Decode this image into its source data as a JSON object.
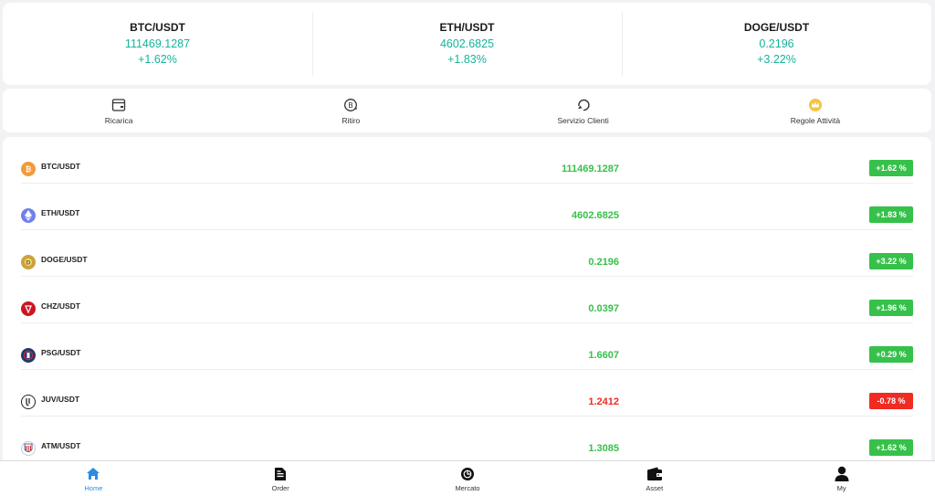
{
  "tickers": [
    {
      "pair": "BTC/USDT",
      "price": "111469.1287",
      "change": "+1.62%"
    },
    {
      "pair": "ETH/USDT",
      "price": "4602.6825",
      "change": "+1.83%"
    },
    {
      "pair": "DOGE/USDT",
      "price": "0.2196",
      "change": "+3.22%"
    }
  ],
  "actions": [
    {
      "label": "Ricarica",
      "icon": "wallet-card-icon"
    },
    {
      "label": "Ritiro",
      "icon": "withdraw-icon"
    },
    {
      "label": "Servizio Clienti",
      "icon": "customer-service-icon"
    },
    {
      "label": "Regole Attività",
      "icon": "activity-rules-crown-icon"
    }
  ],
  "market": {
    "colors": {
      "up": "#36c14a",
      "down": "#ef2b22"
    },
    "rows": [
      {
        "symbol": "BTC/USDT",
        "price": "111469.1287",
        "change": "+1.62 %",
        "trend": "up",
        "coin_icon": "bitcoin-icon",
        "coin_color": "#f39a3c"
      },
      {
        "symbol": "ETH/USDT",
        "price": "4602.6825",
        "change": "+1.83 %",
        "trend": "up",
        "coin_icon": "ethereum-icon",
        "coin_color": "#6f7ef0"
      },
      {
        "symbol": "DOGE/USDT",
        "price": "0.2196",
        "change": "+3.22 %",
        "trend": "up",
        "coin_icon": "dogecoin-icon",
        "coin_color": "#c9a43a"
      },
      {
        "symbol": "CHZ/USDT",
        "price": "0.0397",
        "change": "+1.96 %",
        "trend": "up",
        "coin_icon": "chiliz-icon",
        "coin_color": "#cd1422"
      },
      {
        "symbol": "PSG/USDT",
        "price": "1.6607",
        "change": "+0.29 %",
        "trend": "up",
        "coin_icon": "psg-icon",
        "coin_color": "#1e3a6e"
      },
      {
        "symbol": "JUV/USDT",
        "price": "1.2412",
        "change": "-0.78 %",
        "trend": "down",
        "coin_icon": "juventus-icon",
        "coin_color": "#ffffff"
      },
      {
        "symbol": "ATM/USDT",
        "price": "1.3085",
        "change": "+1.62 %",
        "trend": "up",
        "coin_icon": "atletico-icon",
        "coin_color": "#ffffff"
      }
    ]
  },
  "tabs": [
    {
      "label": "Home",
      "icon": "home-icon",
      "active": true
    },
    {
      "label": "Order",
      "icon": "order-document-icon",
      "active": false
    },
    {
      "label": "Mercato",
      "icon": "market-icon",
      "active": false
    },
    {
      "label": "Asset",
      "icon": "wallet-icon",
      "active": false
    },
    {
      "label": "My",
      "icon": "user-icon",
      "active": false
    }
  ]
}
